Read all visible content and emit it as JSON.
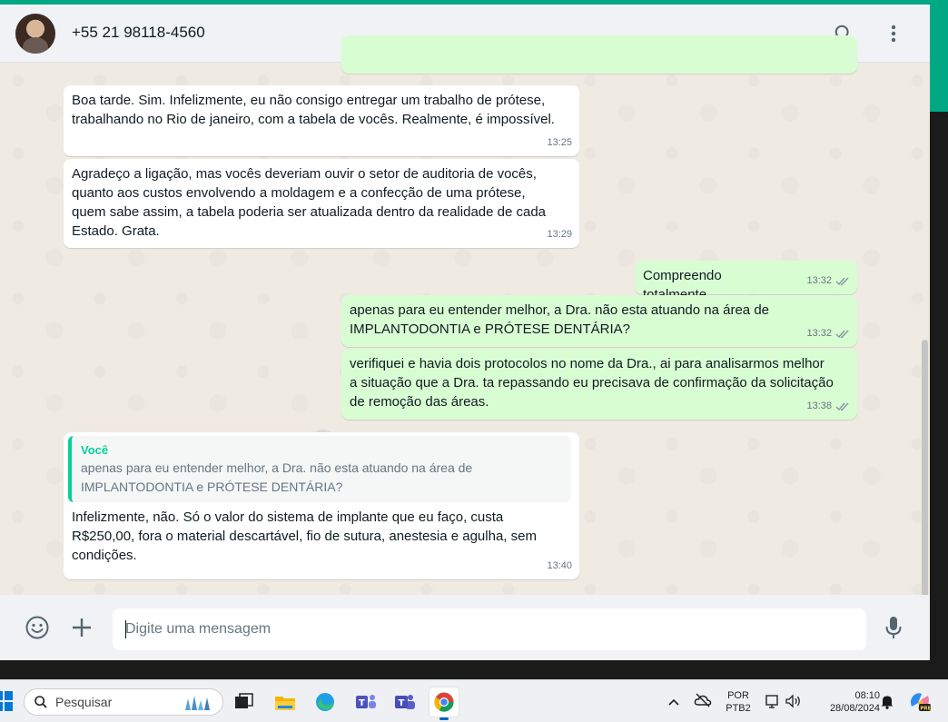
{
  "header": {
    "contact_name": "+55 21 98118-4560",
    "search_icon": "search-icon",
    "menu_icon": "more-vertical-icon"
  },
  "messages": [
    {
      "direction": "in",
      "text": "Boa tarde. Sim. Infelizmente, eu não consigo entregar um trabalho de prótese,\ntrabalhando no Rio de janeiro, com a tabela de vocês. Realmente, é impossível.",
      "time": "13:25"
    },
    {
      "direction": "in",
      "text": "Agradeço a ligação, mas vocês deveriam ouvir o setor de auditoria de vocês,\nquanto aos custos envolvendo a moldagem e a confecção de uma prótese,\nquem sabe assim, a tabela poderia ser atualizada dentro da realidade de cada\nEstado. Grata.",
      "time": "13:29"
    },
    {
      "direction": "out",
      "text": "Compreendo totalmente",
      "time": "13:32",
      "status": "read"
    },
    {
      "direction": "out",
      "text": "apenas para eu entender melhor, a Dra. não esta atuando na área de\nIMPLANTODONTIA e PRÓTESE DENTÁRIA?",
      "time": "13:32",
      "status": "read"
    },
    {
      "direction": "out",
      "text": "verifiquei e havia dois protocolos no nome da Dra., ai para analisarmos melhor\na situação que a Dra. ta repassando eu precisava de confirmação da solicitação\nde remoção das áreas.",
      "time": "13:38",
      "status": "read"
    },
    {
      "direction": "in",
      "quote_author": "Você",
      "quote_text": "apenas para eu entender melhor, a Dra. não esta atuando na área de\nIMPLANTODONTIA e PRÓTESE DENTÁRIA?",
      "text": "Infelizmente, não. Só o valor do sistema de implante que eu faço, custa\nR$250,00, fora o material descartável, fio de sutura, anestesia e agulha, sem\ncondições.",
      "time": "13:40"
    }
  ],
  "composer": {
    "placeholder": "Digite uma mensagem",
    "emoji_icon": "emoji-icon",
    "attach_icon": "plus-icon",
    "mic_icon": "microphone-icon"
  },
  "taskbar": {
    "search_placeholder": "Pesquisar",
    "language_line1": "POR",
    "language_line2": "PTB2",
    "time": "08:10",
    "date": "28/08/2024"
  },
  "colors": {
    "accent": "#00a884",
    "outgoing_bubble": "#d9fdd3",
    "incoming_bubble": "#ffffff",
    "read_ticks": "#53bdeb",
    "quote_bar": "#06cf9c"
  }
}
